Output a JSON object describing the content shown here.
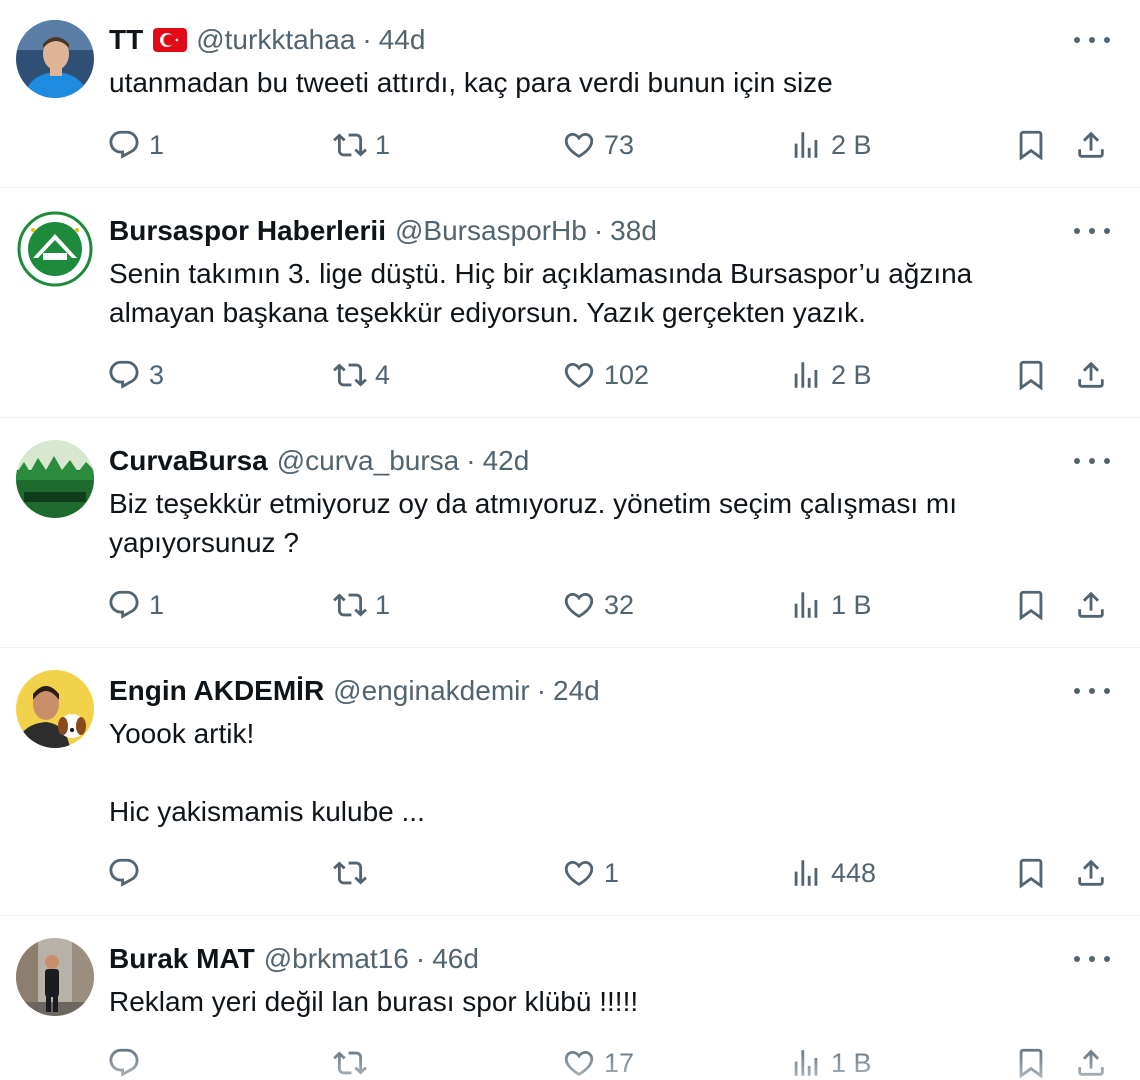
{
  "colors": {
    "text": "#0f1419",
    "secondary": "#536471",
    "divider": "#eff3f4"
  },
  "tweets": [
    {
      "name": "TT",
      "flag": "turkey-flag",
      "handle": "@turkktahaa",
      "dot": "·",
      "age": "44d",
      "text": "utanmadan bu tweeti attırdı, kaç para verdi bunun için size",
      "replies": "1",
      "retweets": "1",
      "likes": "73",
      "views": "2 B"
    },
    {
      "name": "Bursaspor Haberlerii",
      "handle": "@BursasporHb",
      "dot": "·",
      "age": "38d",
      "text": "Senin takımın 3. lige düştü. Hiç bir açıklamasında Bursaspor’u ağzına\nalmayan başkana teşekkür ediyorsun. Yazık gerçekten yazık.",
      "replies": "3",
      "retweets": "4",
      "likes": "102",
      "views": "2 B"
    },
    {
      "name": "CurvaBursa",
      "handle": "@curva_bursa",
      "dot": "·",
      "age": "42d",
      "text": "Biz teşekkür etmiyoruz oy da atmıyoruz. yönetim seçim çalışması mı\nyapıyorsunuz ?",
      "replies": "1",
      "retweets": "1",
      "likes": "32",
      "views": "1 B"
    },
    {
      "name": "Engin AKDEMİR",
      "handle": "@enginakdemir",
      "dot": "·",
      "age": "24d",
      "text": "Yoook artik!\n\nHic yakismamis kulube ...",
      "replies": "",
      "retweets": "",
      "likes": "1",
      "views": "448"
    },
    {
      "name": "Burak MAT",
      "handle": "@brkmat16",
      "dot": "·",
      "age": "46d",
      "text": "Reklam yeri değil lan burası spor klübü !!!!!",
      "replies": "",
      "retweets": "",
      "likes": "17",
      "views": "1 B"
    }
  ]
}
